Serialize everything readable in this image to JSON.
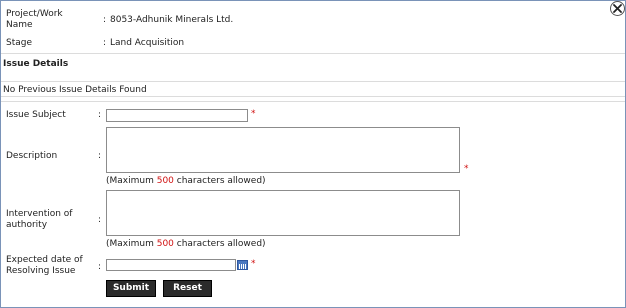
{
  "header": {
    "project_label": "Project/Work\nName",
    "project_value": "8053-Adhunik Minerals Ltd.",
    "stage_label": "Stage",
    "stage_value": "Land Acquisition",
    "colon": ":"
  },
  "section": {
    "title": "Issue Details",
    "notice": "No Previous Issue Details Found"
  },
  "form": {
    "issue_subject_label": "Issue Subject",
    "issue_subject_value": "",
    "description_label": "Description",
    "description_value": "",
    "intervention_label": "Intervention of\nauthority",
    "intervention_value": "",
    "expected_date_label": "Expected date of\nResolving Issue",
    "expected_date_value": "",
    "required_mark": "*",
    "colon": ":",
    "hint_prefix": "(Maximum ",
    "hint_limit": "500",
    "hint_suffix": "  characters allowed)"
  },
  "buttons": {
    "submit": "Submit",
    "reset": "Reset"
  }
}
